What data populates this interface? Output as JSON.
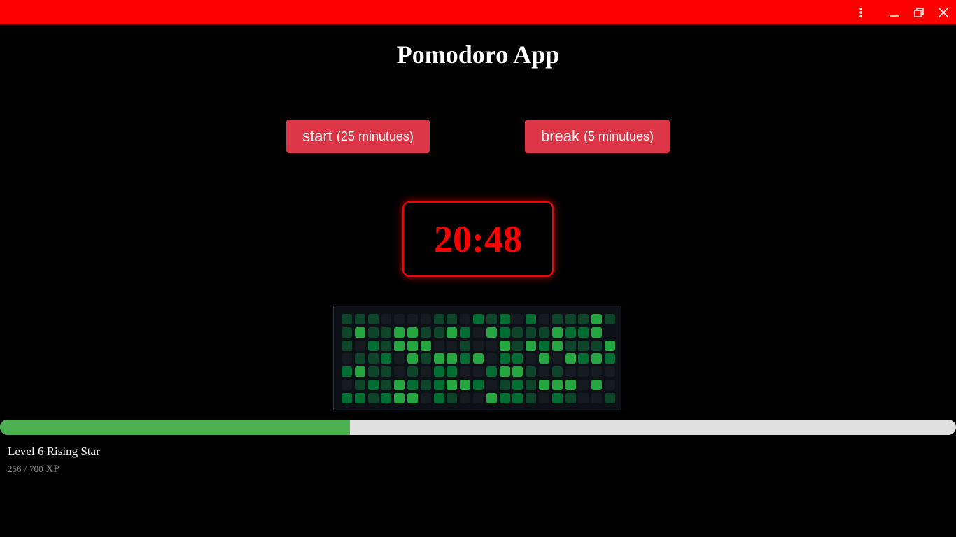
{
  "window": {
    "titlebar_color": "#ff0000",
    "controls": [
      "more-vert-icon",
      "minimize-icon",
      "restore-icon",
      "close-icon"
    ]
  },
  "title": "Pomodoro App",
  "buttons": {
    "start": {
      "label": "start",
      "detail": "(25 minutues)"
    },
    "break": {
      "label": "break",
      "detail": "(5 minutues)"
    },
    "color": "#dc3545"
  },
  "timer": {
    "display": "20:48",
    "color": "#ff0000"
  },
  "heatmap": {
    "palette": [
      "#161b22",
      "#0e4429",
      "#006d32",
      "#26a641",
      "#39d353"
    ],
    "grid": [
      [
        1,
        1,
        1,
        0,
        0,
        0,
        0,
        1,
        1,
        0,
        2,
        1,
        2,
        0,
        2,
        0,
        1,
        1,
        1,
        3,
        1
      ],
      [
        1,
        3,
        1,
        1,
        3,
        3,
        1,
        1,
        3,
        2,
        0,
        3,
        2,
        1,
        1,
        1,
        3,
        2,
        2,
        3
      ],
      [
        1,
        0,
        2,
        1,
        3,
        3,
        3,
        0,
        0,
        1,
        0,
        0,
        3,
        1,
        3,
        2,
        3,
        1,
        1,
        1,
        3
      ],
      [
        0,
        1,
        1,
        2,
        0,
        3,
        1,
        3,
        3,
        2,
        3,
        0,
        2,
        2,
        0,
        3,
        0,
        3,
        2,
        3,
        2
      ],
      [
        2,
        3,
        1,
        1,
        0,
        1,
        0,
        2,
        2,
        0,
        0,
        2,
        3,
        3,
        1,
        0,
        1,
        0,
        0,
        0,
        0
      ],
      [
        0,
        1,
        2,
        1,
        3,
        2,
        1,
        2,
        3,
        3,
        2,
        0,
        1,
        2,
        1,
        3,
        3,
        3,
        0,
        3,
        0
      ],
      [
        2,
        2,
        1,
        2,
        3,
        3,
        0,
        2,
        1,
        0,
        0,
        3,
        2,
        2,
        1,
        0,
        2,
        1,
        0,
        0,
        1
      ]
    ]
  },
  "progress": {
    "value": 256,
    "max": 700,
    "fill_color": "#4caf50",
    "track_color": "#e0e0e0"
  },
  "level": {
    "label": "Level 6 Rising Star"
  },
  "xp": {
    "current": "256",
    "separator": "/",
    "max": "700",
    "unit": "XP"
  }
}
